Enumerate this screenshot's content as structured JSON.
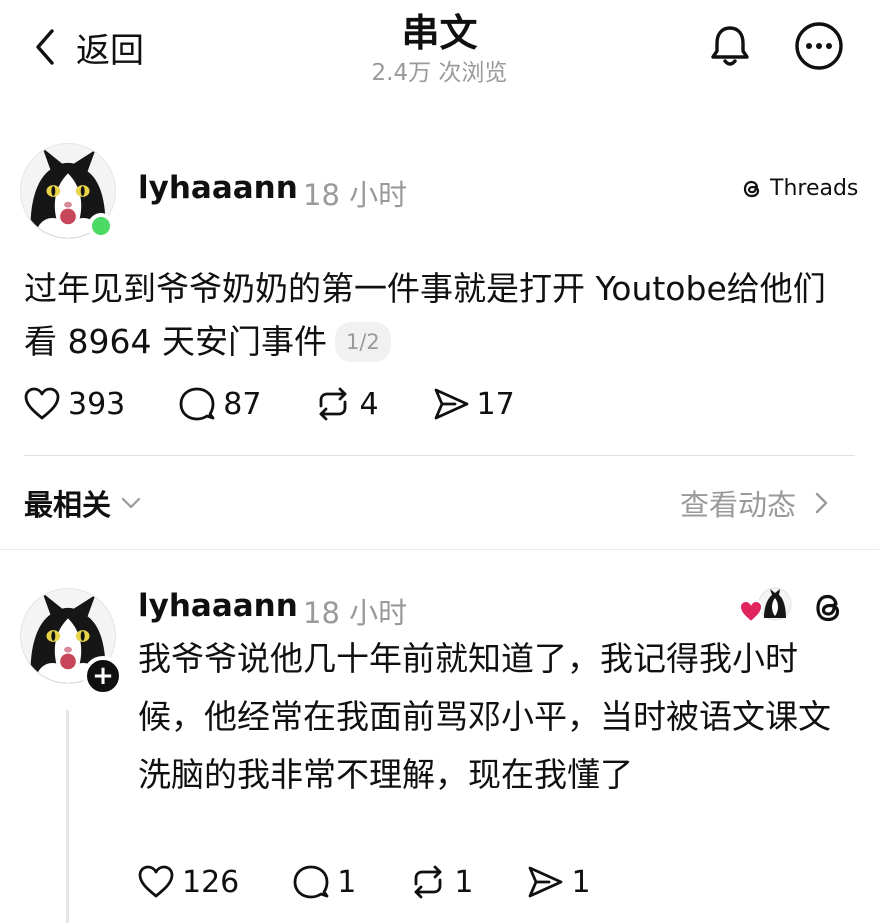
{
  "header": {
    "back_label": "返回",
    "title": "串文",
    "views": "2.4万 次浏览",
    "bell_icon": "bell-icon",
    "more_icon": "more-icon"
  },
  "post": {
    "username": "lyhaaann",
    "time": "18 小时",
    "source": "Threads",
    "text": "过年见到爷爷奶奶的第一件事就是打开 Youtobe给他们看 8964 天安门事件",
    "page_indicator": "1/2",
    "likes": "393",
    "comments": "87",
    "reposts": "4",
    "shares": "17"
  },
  "sort": {
    "label": "最相关",
    "activity_label": "查看动态"
  },
  "reply": {
    "username": "lyhaaann",
    "time": "18 小时",
    "text": "我爷爷说他几十年前就知道了，我记得我小时候，他经常在我面前骂邓小平，当时被语文课文洗脑的我非常不理解，现在我懂了",
    "plus_label": "+",
    "likes": "126",
    "comments": "1",
    "reposts": "1",
    "shares": "1"
  },
  "colors": {
    "text": "#101010",
    "muted": "#9a9a9a",
    "online": "#4cd964",
    "heart": "#e0245e"
  }
}
